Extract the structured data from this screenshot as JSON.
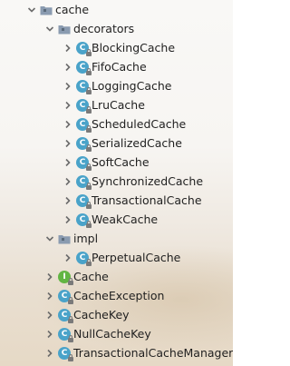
{
  "colors": {
    "folder": "#8a9bb0",
    "package_dot": "#5a6a7a",
    "class_icon": "#4aa3c9",
    "interface_icon": "#62b543",
    "arrow": "#6b6b6b"
  },
  "tree": {
    "root": {
      "label": "cache",
      "expanded": true
    },
    "decorators": {
      "label": "decorators",
      "expanded": true,
      "items": [
        {
          "label": "BlockingCache"
        },
        {
          "label": "FifoCache"
        },
        {
          "label": "LoggingCache"
        },
        {
          "label": "LruCache"
        },
        {
          "label": "ScheduledCache"
        },
        {
          "label": "SerializedCache"
        },
        {
          "label": "SoftCache"
        },
        {
          "label": "SynchronizedCache"
        },
        {
          "label": "TransactionalCache"
        },
        {
          "label": "WeakCache"
        }
      ]
    },
    "impl": {
      "label": "impl",
      "expanded": true,
      "items": [
        {
          "label": "PerpetualCache"
        }
      ]
    },
    "classes": [
      {
        "label": "Cache",
        "kind": "interface",
        "icon_letter": "I"
      },
      {
        "label": "CacheException",
        "kind": "class",
        "icon_letter": "C"
      },
      {
        "label": "CacheKey",
        "kind": "class",
        "icon_letter": "C"
      },
      {
        "label": "NullCacheKey",
        "kind": "class",
        "icon_letter": "C"
      },
      {
        "label": "TransactionalCacheManager",
        "kind": "class",
        "icon_letter": "C"
      }
    ],
    "decorator_icon_letter": "C"
  }
}
